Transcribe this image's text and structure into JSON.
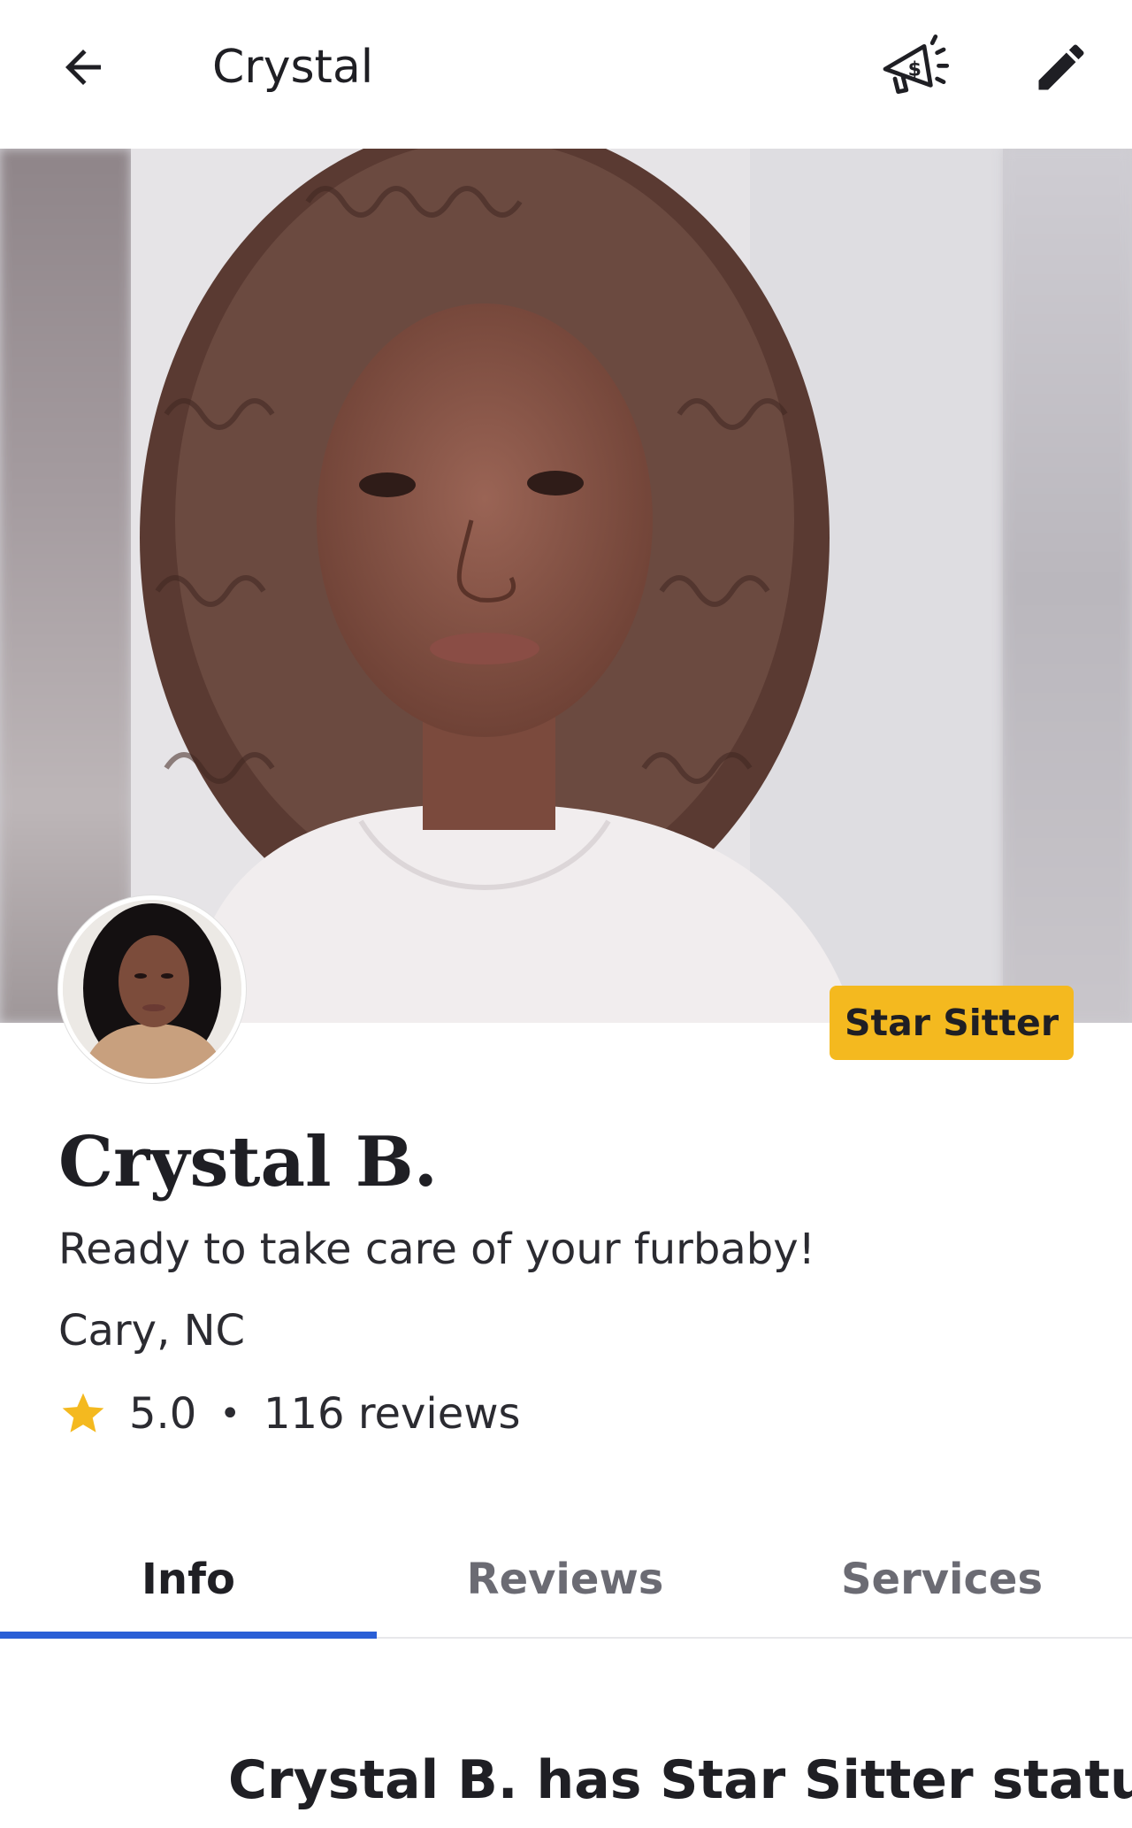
{
  "appbar": {
    "title": "Crystal",
    "back_icon": "arrow-left-icon",
    "promo_icon": "megaphone-dollar-icon",
    "edit_icon": "pencil-icon"
  },
  "profile": {
    "badge": "Star Sitter",
    "name": "Crystal B.",
    "tagline": "Ready to take care of your furbaby!",
    "location": "Cary, NC",
    "rating": "5.0",
    "separator": "•",
    "reviews": "116 reviews"
  },
  "tabs": [
    {
      "label": "Info",
      "active": true
    },
    {
      "label": "Reviews",
      "active": false
    },
    {
      "label": "Services",
      "active": false
    }
  ],
  "section": {
    "heading": "Crystal B. has Star Sitter status"
  },
  "colors": {
    "badge": "#f4b91f",
    "tab_indicator": "#2a5fd6",
    "star": "#f4b91f"
  }
}
